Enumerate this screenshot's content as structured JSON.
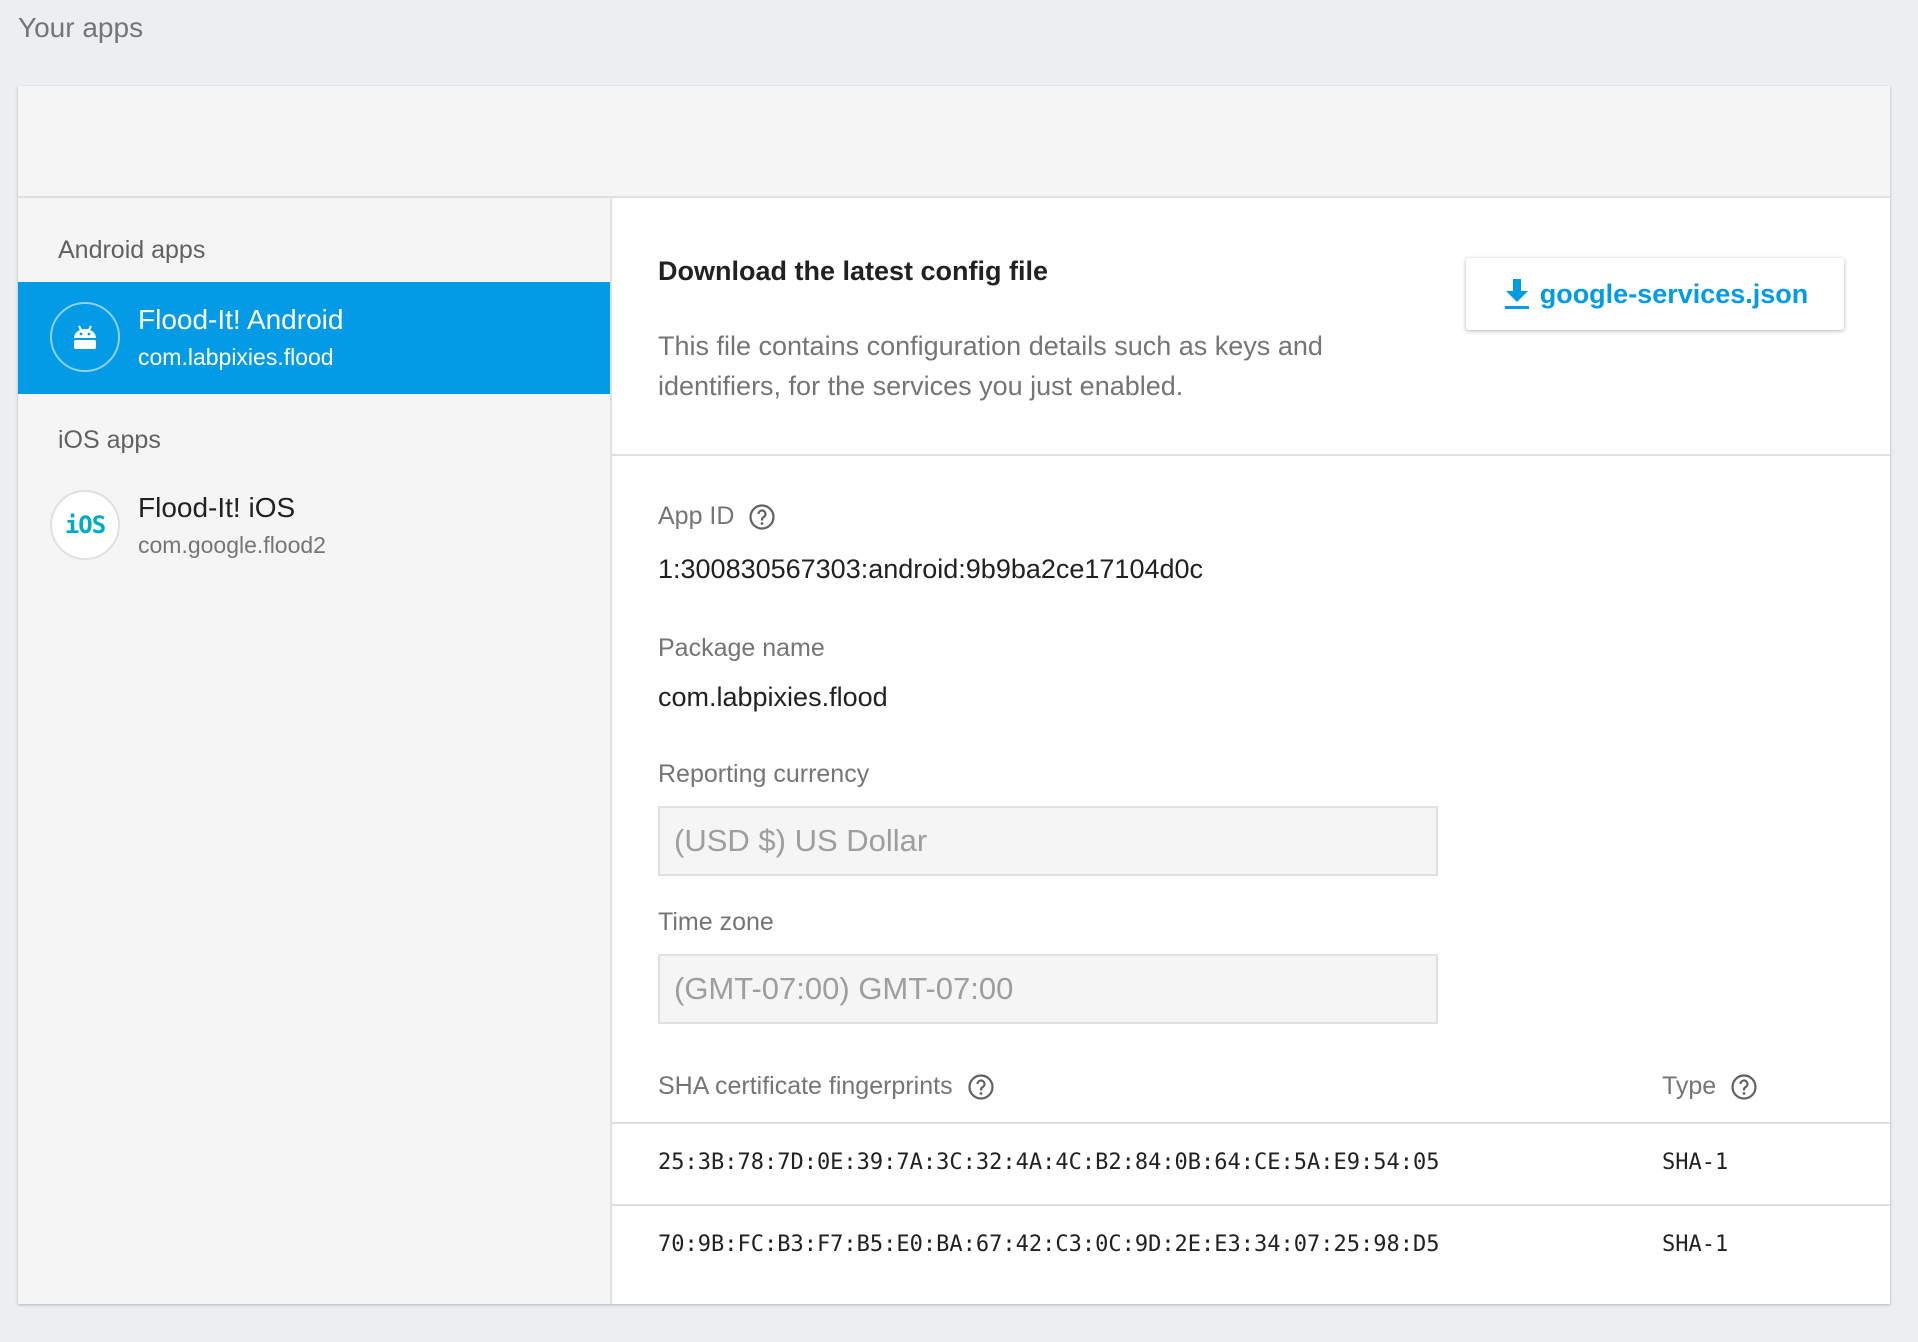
{
  "page": {
    "title": "Your apps"
  },
  "sidebar": {
    "android_section_label": "Android apps",
    "ios_section_label": "iOS apps",
    "android_apps": [
      {
        "name": "Flood-It! Android",
        "package": "com.labpixies.flood",
        "icon": "android-icon",
        "selected": true
      }
    ],
    "ios_apps": [
      {
        "name": "Flood-It! iOS",
        "package": "com.google.flood2",
        "icon_text": "iOS",
        "selected": false
      }
    ]
  },
  "config": {
    "title": "Download the latest config file",
    "description": "This file contains configuration details such as keys and identifiers, for the services you just enabled.",
    "download_label": "google-services.json",
    "download_icon": "download-icon"
  },
  "details": {
    "app_id_label": "App ID",
    "app_id_value": "1:300830567303:android:9b9ba2ce17104d0c",
    "package_label": "Package name",
    "package_value": "com.labpixies.flood",
    "currency_label": "Reporting currency",
    "currency_value": "(USD $) US Dollar",
    "timezone_label": "Time zone",
    "timezone_value": "(GMT-07:00) GMT-07:00"
  },
  "sha": {
    "header_fingerprint": "SHA certificate fingerprints",
    "header_type": "Type",
    "rows": [
      {
        "fingerprint": "25:3B:78:7D:0E:39:7A:3C:32:4A:4C:B2:84:0B:64:CE:5A:E9:54:05",
        "type": "SHA-1"
      },
      {
        "fingerprint": "70:9B:FC:B3:F7:B5:E0:BA:67:42:C3:0C:9D:2E:E3:34:07:25:98:D5",
        "type": "SHA-1"
      }
    ]
  },
  "colors": {
    "accent": "#039be5",
    "ios_icon": "#00acc1",
    "background": "#eceff1"
  }
}
